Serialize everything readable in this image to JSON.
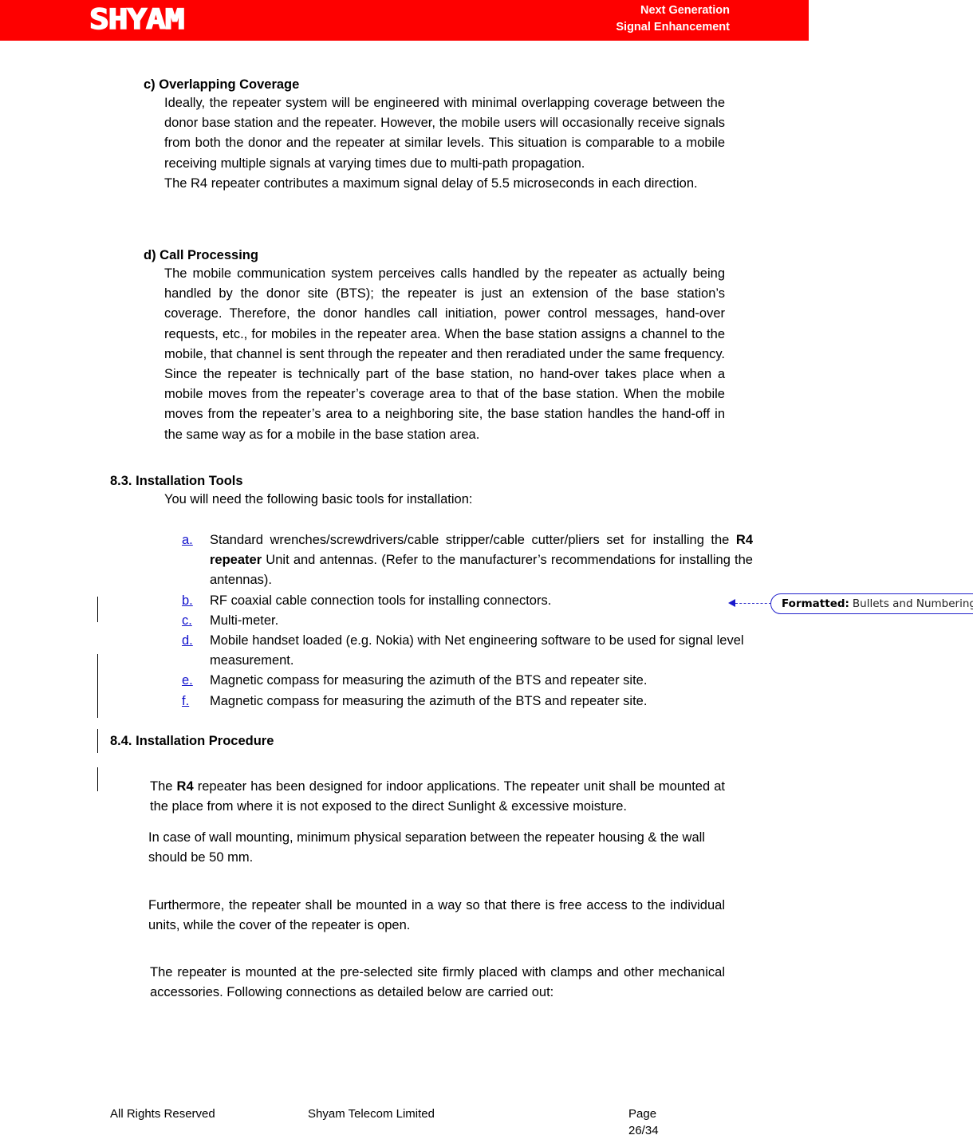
{
  "header": {
    "logo_text": "SHYAM",
    "tagline_line1": "Next Generation",
    "tagline_line2": "Signal Enhancement",
    "band_color": "#fe0000"
  },
  "sections": {
    "c": {
      "heading": "c) Overlapping Coverage",
      "para1": "Ideally, the repeater system will be engineered with minimal overlapping coverage between the donor base station and the repeater. However, the mobile users will occasionally receive signals from both the donor and the repeater at similar levels. This situation is comparable to a mobile receiving multiple signals at varying times due to multi-path propagation.",
      "para2": "The R4 repeater contributes a maximum signal delay of 5.5 microseconds in each direction."
    },
    "d": {
      "heading": "d) Call Processing",
      "para1": "The mobile communication system perceives calls handled by the repeater as actually being handled by the donor site (BTS); the repeater is just an extension of the base station’s coverage. Therefore, the donor handles call initiation, power control messages, hand-over requests, etc., for mobiles in the repeater area. When the base station assigns a channel to the mobile, that channel is sent through the repeater and then reradiated under the same frequency. Since the repeater is technically part of the base station, no hand-over takes place when a mobile moves from the repeater’s coverage area to that of the base station. When the mobile moves from the repeater’s area to a neighboring site, the base station handles the hand-off in the same way as for a mobile in the base station area."
    },
    "tools": {
      "heading": "8.3. Installation Tools",
      "intro": "You will need the following basic tools for installation:",
      "items": [
        {
          "marker": "a.",
          "text_before": "Standard wrenches/screwdrivers/cable stripper/cable cutter/pliers set for installing the ",
          "bold": "R4 repeater",
          "text_after": " Unit and antennas. (Refer to the manufacturer’s recommendations for installing the antennas)."
        },
        {
          "marker": "b.",
          "text_before": "RF coaxial cable connection tools for installing connectors.",
          "bold": "",
          "text_after": ""
        },
        {
          "marker": "c.",
          "text_before": "Multi-meter.",
          "bold": "",
          "text_after": ""
        },
        {
          "marker": "d.",
          "text_before": "Mobile handset loaded (e.g. Nokia) with Net engineering software to be used for signal level measurement.",
          "bold": "",
          "text_after": ""
        },
        {
          "marker": "e.",
          "text_before": "Magnetic compass for measuring the azimuth of the BTS and repeater site.",
          "bold": "",
          "text_after": ""
        },
        {
          "marker": "f.",
          "text_before": "Magnetic compass for measuring the azimuth of the BTS and repeater site.",
          "bold": "",
          "text_after": ""
        }
      ]
    },
    "procedure": {
      "heading": "8.4. Installation Procedure",
      "para1_before": "The ",
      "para1_bold": "R4",
      "para1_after": " repeater has been designed for indoor applications. The repeater unit shall be mounted at the place from where it is not exposed to the direct Sunlight & excessive moisture.",
      "para2": "In case of wall mounting, minimum physical separation between the repeater housing & the wall should be 50 mm.",
      "para3": "Furthermore, the repeater shall be mounted in a way so that there is free access to the individual units, while the cover of the repeater is open.",
      "para4": "The repeater is mounted at the pre-selected site firmly placed with clamps and other mechanical accessories. Following connections as detailed below are carried out:"
    }
  },
  "callout": {
    "label": "Formatted:",
    "value": "Bullets and Numbering",
    "border_color": "#2222cc"
  },
  "footer": {
    "left": "All Rights Reserved",
    "center": "Shyam Telecom Limited",
    "page_label": "Page",
    "page_value": "26/34"
  }
}
